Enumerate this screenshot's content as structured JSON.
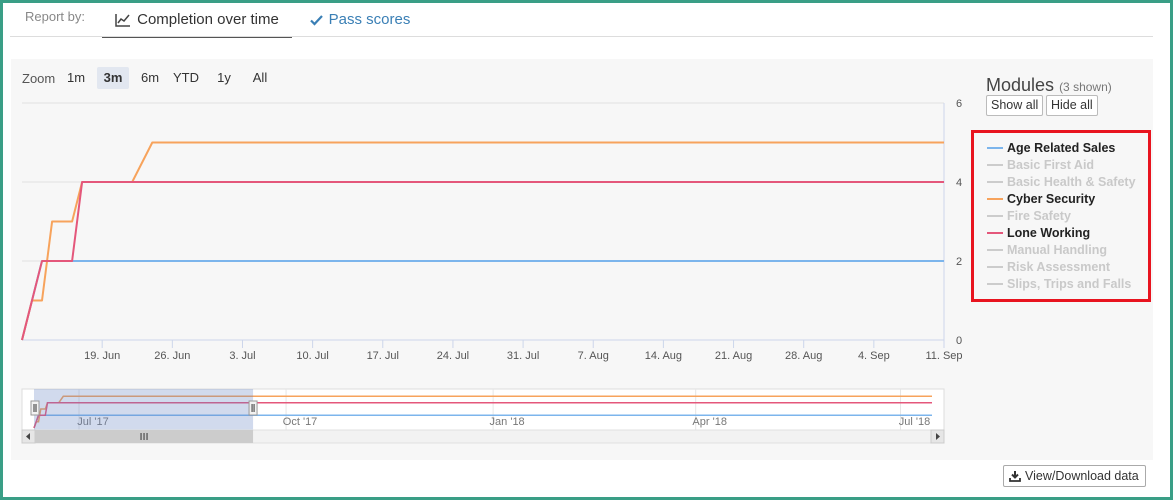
{
  "report_by": {
    "label": "Report by:",
    "tabs": [
      {
        "label": "Completion over time",
        "icon": "line-chart-icon",
        "active": true
      },
      {
        "label": "Pass scores",
        "icon": "check-icon",
        "active": false
      }
    ]
  },
  "zoom": {
    "label": "Zoom",
    "options": [
      "1m",
      "3m",
      "6m",
      "YTD",
      "1y",
      "All"
    ],
    "selected": "3m"
  },
  "legend": {
    "title": "Modules",
    "shown_text": "(3 shown)",
    "show_all": "Show all",
    "hide_all": "Hide all",
    "items": [
      {
        "name": "Age Related Sales",
        "visible": true,
        "color": "#7cb5ec"
      },
      {
        "name": "Basic First Aid",
        "visible": false,
        "color": "#cccccc"
      },
      {
        "name": "Basic Health & Safety",
        "visible": false,
        "color": "#cccccc"
      },
      {
        "name": "Cyber Security",
        "visible": true,
        "color": "#f7a35c"
      },
      {
        "name": "Fire Safety",
        "visible": false,
        "color": "#cccccc"
      },
      {
        "name": "Lone Working",
        "visible": true,
        "color": "#e4577b"
      },
      {
        "name": "Manual Handling",
        "visible": false,
        "color": "#cccccc"
      },
      {
        "name": "Risk Assessment",
        "visible": false,
        "color": "#cccccc"
      },
      {
        "name": "Slips, Trips and Falls",
        "visible": false,
        "color": "#cccccc"
      }
    ]
  },
  "view_download": "View/Download data",
  "chart_data": {
    "type": "line",
    "ylim": [
      0,
      6
    ],
    "y_ticks": [
      0,
      2,
      4,
      6
    ],
    "x_range": [
      "2017-06-11",
      "2017-09-11"
    ],
    "x_tick_labels": [
      "19. Jun",
      "26. Jun",
      "3. Jul",
      "10. Jul",
      "17. Jul",
      "24. Jul",
      "31. Jul",
      "7. Aug",
      "14. Aug",
      "21. Aug",
      "28. Aug",
      "4. Sep",
      "11. Sep"
    ],
    "x_tick_dates": [
      "2017-06-19",
      "2017-06-26",
      "2017-07-03",
      "2017-07-10",
      "2017-07-17",
      "2017-07-24",
      "2017-07-31",
      "2017-08-07",
      "2017-08-14",
      "2017-08-21",
      "2017-08-28",
      "2017-09-04",
      "2017-09-11"
    ],
    "grid": true,
    "legend_position": "right",
    "series": [
      {
        "name": "Age Related Sales",
        "color": "#7cb5ec",
        "points": [
          [
            "2017-06-11",
            0
          ],
          [
            "2017-06-13",
            2
          ],
          [
            "2017-09-11",
            2
          ]
        ]
      },
      {
        "name": "Cyber Security",
        "color": "#f7a35c",
        "points": [
          [
            "2017-06-11",
            0
          ],
          [
            "2017-06-12",
            1
          ],
          [
            "2017-06-13",
            1
          ],
          [
            "2017-06-14",
            3
          ],
          [
            "2017-06-16",
            3
          ],
          [
            "2017-06-17",
            4
          ],
          [
            "2017-06-22",
            4
          ],
          [
            "2017-06-24",
            5
          ],
          [
            "2017-09-11",
            5
          ]
        ]
      },
      {
        "name": "Lone Working",
        "color": "#e4577b",
        "points": [
          [
            "2017-06-11",
            0
          ],
          [
            "2017-06-13",
            2
          ],
          [
            "2017-06-16",
            2
          ],
          [
            "2017-06-17",
            4
          ],
          [
            "2017-09-11",
            4
          ]
        ]
      }
    ],
    "navigator": {
      "x_tick_labels": [
        "Jul '17",
        "Oct '17",
        "Jan '18",
        "Apr '18",
        "Jul '18"
      ],
      "x_tick_dates": [
        "2017-07-01",
        "2017-10-01",
        "2018-01-01",
        "2018-04-01",
        "2018-07-01"
      ],
      "range": [
        "2017-06-11",
        "2018-07-15"
      ],
      "selection": [
        "2017-06-11",
        "2017-09-11"
      ]
    }
  }
}
